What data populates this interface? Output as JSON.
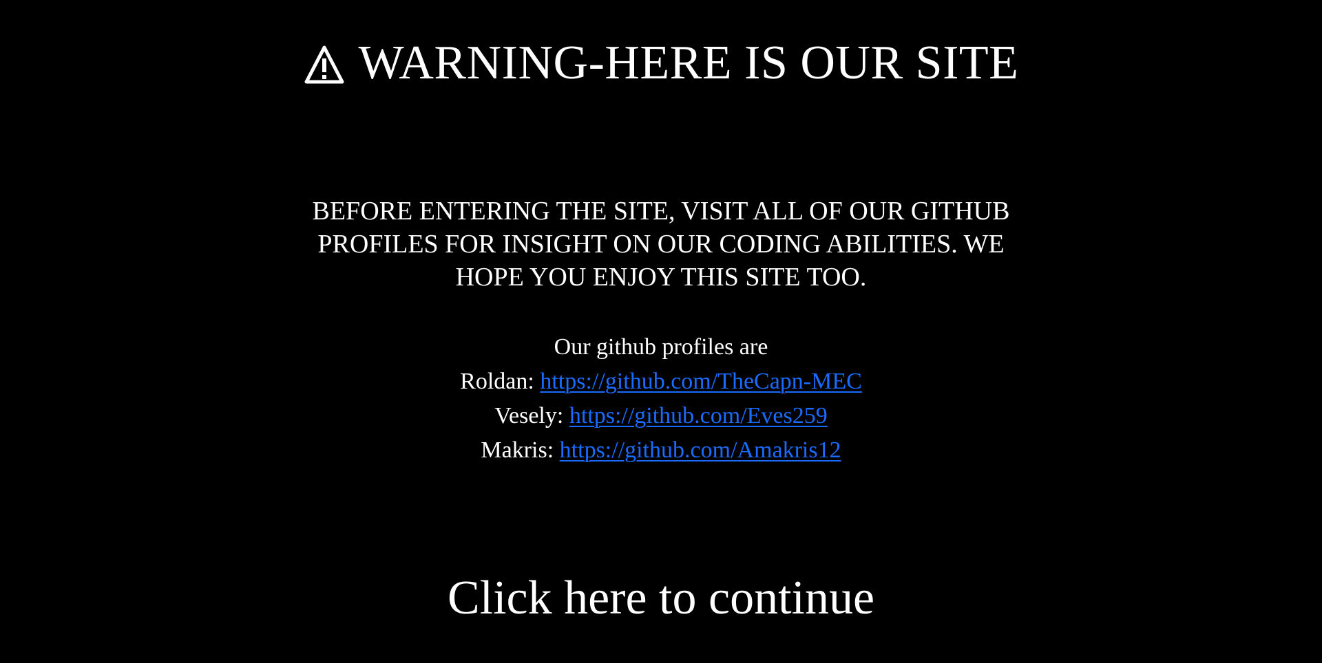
{
  "header": {
    "warning_icon": "warning-triangle-icon",
    "title": "WARNING-HERE IS OUR SITE"
  },
  "intro": {
    "text": "BEFORE ENTERING THE SITE, VISIT ALL OF OUR GITHUB PROFILES FOR INSIGHT ON OUR CODING ABILITIES. WE HOPE YOU ENJOY THIS SITE TOO."
  },
  "profiles": {
    "heading": "Our github profiles are",
    "items": [
      {
        "name": "Roldan:",
        "url": "https://github.com/TheCapn-MEC"
      },
      {
        "name": "Vesely:",
        "url": "https://github.com/Eves259"
      },
      {
        "name": "Makris:",
        "url": "https://github.com/Amakris12"
      }
    ]
  },
  "continue": {
    "label": "Click here to continue"
  },
  "colors": {
    "background": "#000000",
    "text": "#ffffff",
    "link": "#1a6bff"
  }
}
